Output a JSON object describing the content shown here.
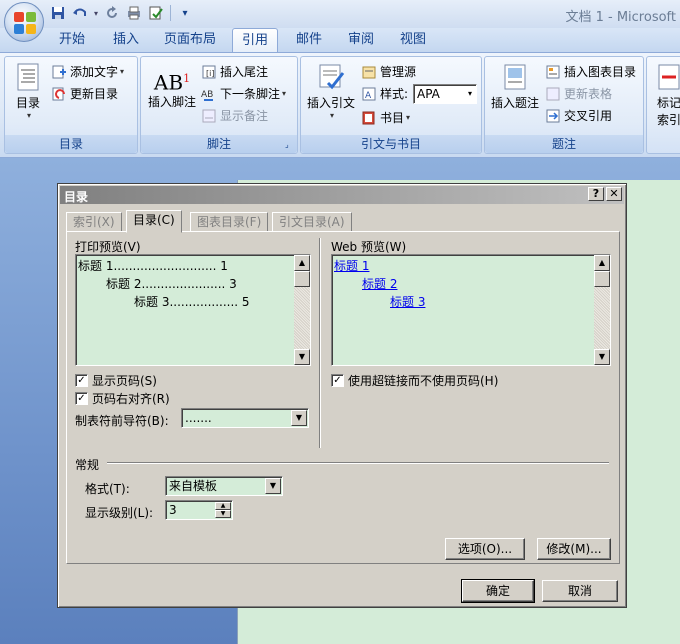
{
  "window": {
    "title": "文档 1 - Microsoft"
  },
  "qat": {
    "icons": [
      "save-icon",
      "undo-icon",
      "redo-icon",
      "print-preview-icon",
      "spelling-icon",
      "customize-icon"
    ]
  },
  "tabs": [
    "开始",
    "插入",
    "页面布局",
    "引用",
    "邮件",
    "审阅",
    "视图"
  ],
  "active_tab": "引用",
  "ribbon": {
    "toc_group": {
      "label": "目录",
      "toc_button": "目录",
      "add_text": "添加文字",
      "update_toc": "更新目录"
    },
    "footnote_group": {
      "label": "脚注",
      "insert_footnote": "插入脚注",
      "ab_glyph": "AB",
      "ab_sup": "1",
      "insert_endnote": "插入尾注",
      "next_footnote": "下一条脚注",
      "show_notes": "显示备注"
    },
    "citation_group": {
      "label": "引文与书目",
      "insert_citation": "插入引文",
      "manage_sources": "管理源",
      "style_label": "样式:",
      "style_value": "APA",
      "bibliography": "书目"
    },
    "caption_group": {
      "label": "题注",
      "insert_caption": "插入题注",
      "insert_table_of_figures": "插入图表目录",
      "update_table": "更新表格",
      "cross_reference": "交叉引用"
    },
    "index_group": {
      "line1": "标记",
      "line2": "索引"
    }
  },
  "dialog": {
    "title": "目录",
    "help_btn": "?",
    "close_btn": "✕",
    "tabs": [
      "索引(X)",
      "目录(C)",
      "图表目录(F)",
      "引文目录(A)"
    ],
    "active_tab": "目录(C)",
    "print_preview_label": "打印预览(V)",
    "print_preview_lines": [
      {
        "text": "标题 1........................... 1"
      },
      {
        "text": "标题 2...................... 3"
      },
      {
        "text": "标题 3.................. 5"
      }
    ],
    "web_preview_label": "Web 预览(W)",
    "web_preview_links": [
      "标题 1",
      "标题 2",
      "标题 3"
    ],
    "show_page_numbers": {
      "label": "显示页码(S)",
      "checked": true
    },
    "right_align": {
      "label": "页码右对齐(R)",
      "checked": true
    },
    "tab_leader_label": "制表符前导符(B):",
    "tab_leader_value": ".......",
    "use_hyperlinks": {
      "label": "使用超链接而不使用页码(H)",
      "checked": true
    },
    "general_label": "常规",
    "format_label": "格式(T):",
    "format_value": "来自模板",
    "levels_label": "显示级别(L):",
    "levels_value": "3",
    "options_btn": "选项(O)...",
    "modify_btn": "修改(M)...",
    "ok_btn": "确定",
    "cancel_btn": "取消",
    "check_glyph": "✓"
  }
}
